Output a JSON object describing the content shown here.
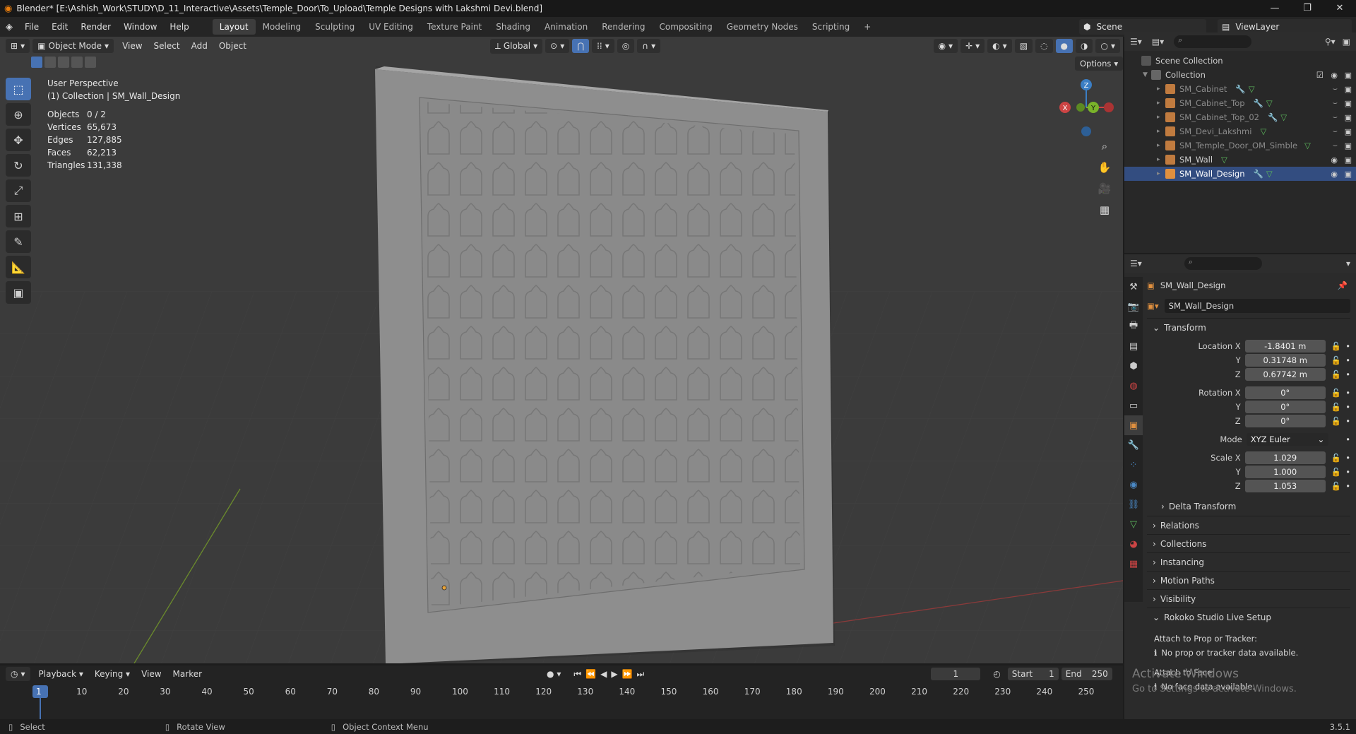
{
  "window": {
    "title": "Blender* [E:\\Ashish_Work\\STUDY\\D_11_Interactive\\Assets\\Temple_Door\\To_Upload\\Temple Designs with Lakshmi Devi.blend]",
    "minimize": "—",
    "maximize": "❐",
    "close": "✕"
  },
  "menu": [
    "File",
    "Edit",
    "Render",
    "Window",
    "Help"
  ],
  "workspaces": [
    "Layout",
    "Modeling",
    "Sculpting",
    "UV Editing",
    "Texture Paint",
    "Shading",
    "Animation",
    "Rendering",
    "Compositing",
    "Geometry Nodes",
    "Scripting",
    "+"
  ],
  "active_workspace": "Layout",
  "scene": {
    "label": "Scene",
    "viewlayer": "ViewLayer"
  },
  "viewport_header": {
    "mode": "Object Mode",
    "view": "View",
    "select": "Select",
    "add": "Add",
    "object": "Object",
    "orientation": "Global",
    "options": "Options"
  },
  "viewport": {
    "perspective": "User Perspective",
    "collection": "(1) Collection | SM_Wall_Design"
  },
  "stats": [
    {
      "k": "Objects",
      "v": "0 / 2"
    },
    {
      "k": "Vertices",
      "v": "65,673"
    },
    {
      "k": "Edges",
      "v": "127,885"
    },
    {
      "k": "Faces",
      "v": "62,213"
    },
    {
      "k": "Triangles",
      "v": "131,338"
    }
  ],
  "gizmo": {
    "x": "X",
    "y": "Y",
    "z": "Z"
  },
  "outliner": {
    "root": "Scene Collection",
    "collection": "Collection",
    "items": [
      {
        "name": "SM_Cabinet"
      },
      {
        "name": "SM_Cabinet_Top"
      },
      {
        "name": "SM_Cabinet_Top_02"
      },
      {
        "name": "SM_Devi_Lakshmi"
      },
      {
        "name": "SM_Temple_Door_OM_Simble"
      },
      {
        "name": "SM_Wall"
      },
      {
        "name": "SM_Wall_Design"
      }
    ]
  },
  "properties": {
    "object_name": "SM_Wall_Design",
    "datablock": "SM_Wall_Design",
    "transform": "Transform",
    "location": {
      "label": "Location X",
      "x": "-1.8401 m",
      "y": "0.31748 m",
      "z": "0.67742 m"
    },
    "rotation": {
      "label": "Rotation X",
      "x": "0°",
      "y": "0°",
      "z": "0°"
    },
    "mode": {
      "label": "Mode",
      "value": "XYZ Euler"
    },
    "scale": {
      "label": "Scale X",
      "x": "1.029",
      "y": "1.000",
      "z": "1.053"
    },
    "axis": {
      "y": "Y",
      "z": "Z"
    },
    "sections": [
      "Delta Transform",
      "Relations",
      "Collections",
      "Instancing",
      "Motion Paths",
      "Visibility",
      "Rokoko Studio Live Setup"
    ],
    "attach_prop": "Attach to Prop or Tracker:",
    "no_prop": "No prop or tracker data available.",
    "attach_face": "Attach to Face:",
    "no_face": "No face data available."
  },
  "timeline": {
    "playback": "Playback",
    "keying": "Keying",
    "view": "View",
    "marker": "Marker",
    "frame": "1",
    "start_label": "Start",
    "start": "1",
    "end_label": "End",
    "end": "250",
    "ticks": [
      "1",
      "10",
      "20",
      "30",
      "40",
      "50",
      "60",
      "70",
      "80",
      "90",
      "100",
      "110",
      "120",
      "130",
      "140",
      "150",
      "160",
      "170",
      "180",
      "190",
      "200",
      "210",
      "220",
      "230",
      "240",
      "250"
    ]
  },
  "watermark": {
    "line1": "Activate Windows",
    "line2": "Go to Settings to activate Windows."
  },
  "status": {
    "select": "Select",
    "rotate": "Rotate View",
    "context": "Object Context Menu",
    "version": "3.5.1"
  }
}
